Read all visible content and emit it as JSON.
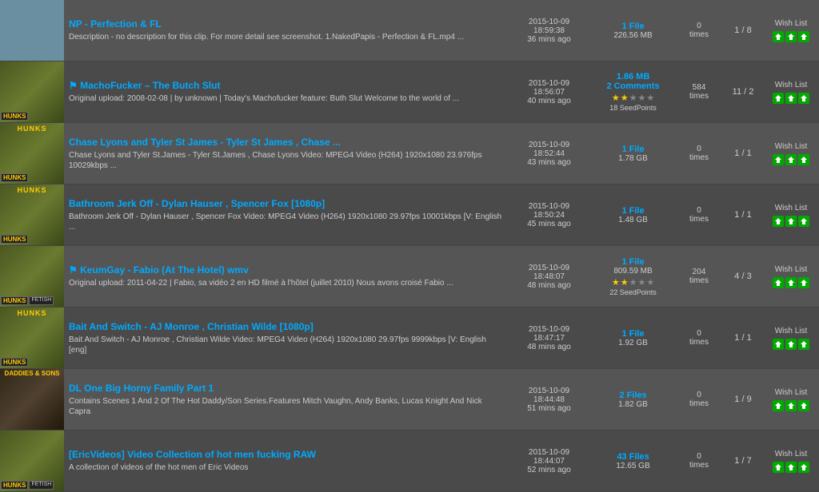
{
  "rows": [
    {
      "id": 1,
      "thumb_bg": "#6a8fa0",
      "thumb_labels": [],
      "thumb_top_label": "",
      "title": "NP - Perfection & FL",
      "desc": "Description - no description for this clip. For more detail see screenshot. 1.NakedPapis - Perfection & FL.mp4 ...",
      "date": "2015-10-09",
      "time": "18:59:38",
      "ago": "36 mins ago",
      "files_label": "1 File",
      "file_size": "226.56 MB",
      "comments_label": "",
      "stars": 0,
      "stars_filled": 0,
      "seedpoints": "",
      "times": "0",
      "ratio": "1 / 8",
      "wish_text": "Wish List",
      "dl_icons": 3
    },
    {
      "id": 2,
      "thumb_bg": "#8a7060",
      "thumb_labels": [
        "HUNKS"
      ],
      "thumb_top_label": "",
      "title": "⚑ MachoFucker – The Butch Slut",
      "desc": "Original upload: 2008-02-08 | by unknown | Today's Machofucker feature: Buth Slut Welcome to the world of ...",
      "date": "2015-10-09",
      "time": "18:56:07",
      "ago": "40 mins ago",
      "files_label": "1.86 MB",
      "file_size": "",
      "comments_label": "2 Comments",
      "stars": 5,
      "stars_filled": 2,
      "seedpoints": "18 SeedPoints",
      "times": "584",
      "ratio": "11 / 2",
      "wish_text": "Wish List",
      "dl_icons": 3
    },
    {
      "id": 3,
      "thumb_bg": "#5a6030",
      "thumb_labels": [
        "HUNKS"
      ],
      "thumb_top_label": "HUNKS",
      "title": "Chase Lyons and Tyler St James - Tyler St James , Chase ...",
      "desc": "Chase Lyons and Tyler St.James - Tyler St.James , Chase Lyons Video: MPEG4 Video (H264) 1920x1080 23.976fps 10029kbps ...",
      "date": "2015-10-09",
      "time": "18:52:44",
      "ago": "43 mins ago",
      "files_label": "1 File",
      "file_size": "1.78 GB",
      "comments_label": "",
      "stars": 0,
      "stars_filled": 0,
      "seedpoints": "",
      "times": "0",
      "ratio": "1 / 1",
      "wish_text": "Wish List",
      "dl_icons": 3
    },
    {
      "id": 4,
      "thumb_bg": "#405070",
      "thumb_labels": [
        "HUNKS"
      ],
      "thumb_top_label": "HUNKS",
      "title": "Bathroom Jerk Off - Dylan Hauser , Spencer Fox [1080p]",
      "desc": "Bathroom Jerk Off - Dylan Hauser , Spencer Fox Video: MPEG4 Video (H264) 1920x1080 29.97fps 10001kbps [V: English ...",
      "date": "2015-10-09",
      "time": "18:50:24",
      "ago": "45 mins ago",
      "files_label": "1 File",
      "file_size": "1.48 GB",
      "comments_label": "",
      "stars": 0,
      "stars_filled": 0,
      "seedpoints": "",
      "times": "0",
      "ratio": "1 / 1",
      "wish_text": "Wish List",
      "dl_icons": 3
    },
    {
      "id": 5,
      "thumb_bg": "#705060",
      "thumb_labels": [
        "HUNKS",
        "FETISH"
      ],
      "thumb_top_label": "",
      "title": "⚑ KeumGay - Fabio (At The Hotel) wmv",
      "desc": "Original upload: 2011-04-22 | Fabio, sa vidéo 2 en HD filmé à l'hôtel (juillet 2010) Nous avons croisé Fabio ...",
      "date": "2015-10-09",
      "time": "18:48:07",
      "ago": "48 mins ago",
      "files_label": "1 File",
      "file_size": "809.59 MB",
      "comments_label": "",
      "stars": 5,
      "stars_filled": 2,
      "seedpoints": "22 SeedPoints",
      "times": "204",
      "ratio": "4 / 3",
      "wish_text": "Wish List",
      "dl_icons": 3
    },
    {
      "id": 6,
      "thumb_bg": "#4a5820",
      "thumb_labels": [
        "HUNKS"
      ],
      "thumb_top_label": "HUNKS",
      "title": "Bait And Switch - AJ Monroe , Christian Wilde [1080p]",
      "desc": "Bait And Switch - AJ Monroe , Christian Wilde Video: MPEG4 Video (H264) 1920x1080 29.97fps 9999kbps [V: English [eng]",
      "date": "2015-10-09",
      "time": "18:47:17",
      "ago": "48 mins ago",
      "files_label": "1 File",
      "file_size": "1.92 GB",
      "comments_label": "",
      "stars": 0,
      "stars_filled": 0,
      "seedpoints": "",
      "times": "0",
      "ratio": "1 / 1",
      "wish_text": "Wish List",
      "dl_icons": 3
    },
    {
      "id": 7,
      "thumb_bg": "#302818",
      "thumb_labels": [],
      "thumb_top_label": "DADDIES & SONS",
      "title": "DL One Big Horny Family Part 1",
      "desc": "Contains Scenes 1 And 2 Of The Hot Daddy/Son Series.Features Mitch Vaughn, Andy Banks, Lucas Knight And Nick Capra",
      "date": "2015-10-09",
      "time": "18:44:48",
      "ago": "51 mins ago",
      "files_label": "2 Files",
      "file_size": "1.82 GB",
      "comments_label": "",
      "stars": 0,
      "stars_filled": 0,
      "seedpoints": "",
      "times": "0",
      "ratio": "1 / 9",
      "wish_text": "Wish List",
      "dl_icons": 3
    },
    {
      "id": 8,
      "thumb_bg": "#404040",
      "thumb_labels": [
        "HUNKS",
        "FETISH"
      ],
      "thumb_top_label": "",
      "title": "[EricVideos] Video Collection of hot men fucking RAW",
      "desc": "A collection of videos of the hot men of Eric Videos",
      "date": "2015-10-09",
      "time": "18:44:07",
      "ago": "52 mins ago",
      "files_label": "43 Files",
      "file_size": "12.65 GB",
      "comments_label": "",
      "stars": 0,
      "stars_filled": 0,
      "seedpoints": "",
      "times": "0",
      "ratio": "1 / 7",
      "wish_text": "Wish List",
      "dl_icons": 3
    }
  ]
}
